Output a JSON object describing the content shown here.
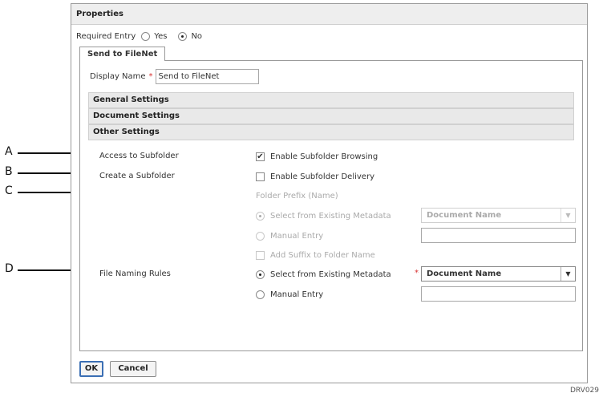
{
  "dialog": {
    "title": "Properties",
    "required_entry": {
      "label": "Required Entry",
      "options": [
        "Yes",
        "No"
      ],
      "selected": "No"
    },
    "tab": "Send to FileNet",
    "display_name": {
      "label": "Display Name",
      "value": "Send to FileNet"
    },
    "sections": [
      "General Settings",
      "Document Settings",
      "Other Settings"
    ],
    "other_settings": {
      "access_label": "Access to Subfolder",
      "access_option": "Enable Subfolder Browsing",
      "create_label": "Create a Subfolder",
      "create_option": "Enable Subfolder Delivery",
      "folder_prefix": "Folder Prefix (Name)",
      "prefix_existing": "Select from Existing Metadata",
      "prefix_manual": "Manual Entry",
      "prefix_select_value": "Document Name",
      "add_suffix": "Add Suffix to Folder Name",
      "naming_label": "File Naming Rules",
      "naming_existing": "Select from Existing Metadata",
      "naming_manual": "Manual Entry",
      "naming_select_value": "Document Name"
    },
    "buttons": {
      "ok": "OK",
      "cancel": "Cancel"
    }
  },
  "callouts": [
    "A",
    "B",
    "C",
    "D"
  ],
  "figure_ref": "DRV029"
}
